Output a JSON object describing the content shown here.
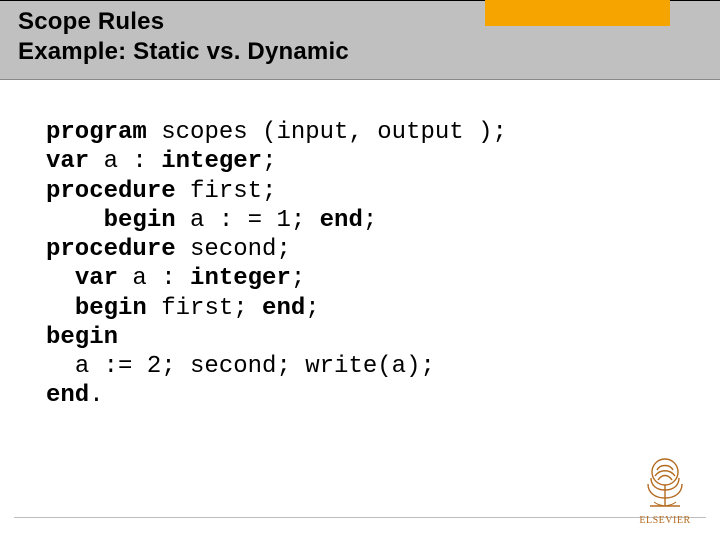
{
  "header": {
    "title_line1": "Scope Rules",
    "title_line2": "Example: Static vs. Dynamic"
  },
  "code": {
    "l1": {
      "kw": "program",
      "rest": " scopes (input, output );"
    },
    "l2": {
      "kw1": "var",
      "mid": " a : ",
      "kw2": "integer",
      "rest": ";"
    },
    "l3": {
      "kw": "procedure",
      "rest": " first;"
    },
    "l4": {
      "indent": "    ",
      "kw1": "begin",
      "mid": " a : = 1; ",
      "kw2": "end",
      "rest": ";"
    },
    "l5": {
      "kw": "procedure",
      "rest": " second;"
    },
    "l6": {
      "indent": "  ",
      "kw1": "var",
      "mid": " a : ",
      "kw2": "integer",
      "rest": ";"
    },
    "l7": {
      "indent": "  ",
      "kw1": "begin",
      "mid": " first; ",
      "kw2": "end",
      "rest": ";"
    },
    "l8": {
      "kw": "begin"
    },
    "l9": {
      "indent": "  ",
      "rest": "a := 2; second; write(a);"
    },
    "l10": {
      "kw": "end",
      "rest": "."
    }
  },
  "logo": {
    "brand": "ELSEVIER",
    "icon": "tree-icon"
  }
}
